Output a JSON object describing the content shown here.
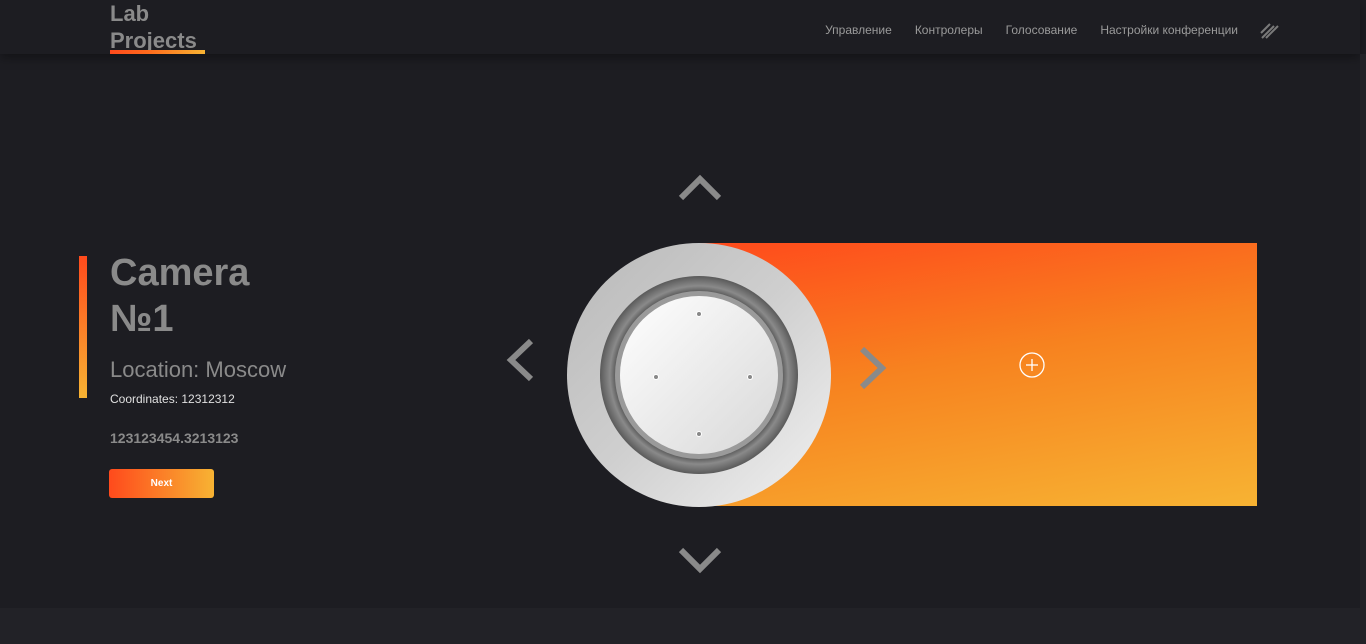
{
  "header": {
    "logo": {
      "line1": "Lab",
      "line2": "Projects"
    },
    "nav": [
      {
        "label": "Управление"
      },
      {
        "label": "Контролеры"
      },
      {
        "label": "Голосование"
      },
      {
        "label": "Настройки конференции"
      }
    ],
    "menu_icon": "diagonal-lines-icon"
  },
  "camera": {
    "title_line1": "Camera",
    "title_line2": "№1",
    "location": "Location: Moscow",
    "coordinates": "Coordinates: 12312312",
    "value": "123123454.3213123",
    "next_label": "Next"
  },
  "controls": {
    "icons": [
      "chevron-up-icon",
      "chevron-down-icon",
      "chevron-left-icon",
      "chevron-right-icon",
      "add-circle-icon"
    ]
  },
  "colors": {
    "background": "#1d1d22",
    "accent_start": "#ff4a1c",
    "accent_end": "#f7b333",
    "text_muted": "#8a8a8a",
    "marker_blue": "#2f6fe0"
  }
}
